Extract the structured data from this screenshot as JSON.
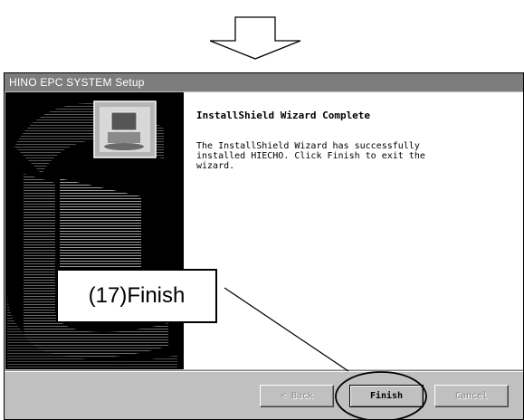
{
  "dialog": {
    "title": "HINO  EPC SYSTEM Setup",
    "heading": "InstallShield Wizard Complete",
    "message": "The InstallShield Wizard has successfully\ninstalled HIECHO.  Click Finish to exit the\nwizard.",
    "buttons": {
      "back": "< Back",
      "finish": "Finish",
      "cancel": "Cancel"
    }
  },
  "annotation": {
    "callout_text": "(17)Finish"
  },
  "colors": {
    "titlebar": "#7d7d7d",
    "dialog_face": "#c0c0c0",
    "side_panel": "#000000"
  }
}
